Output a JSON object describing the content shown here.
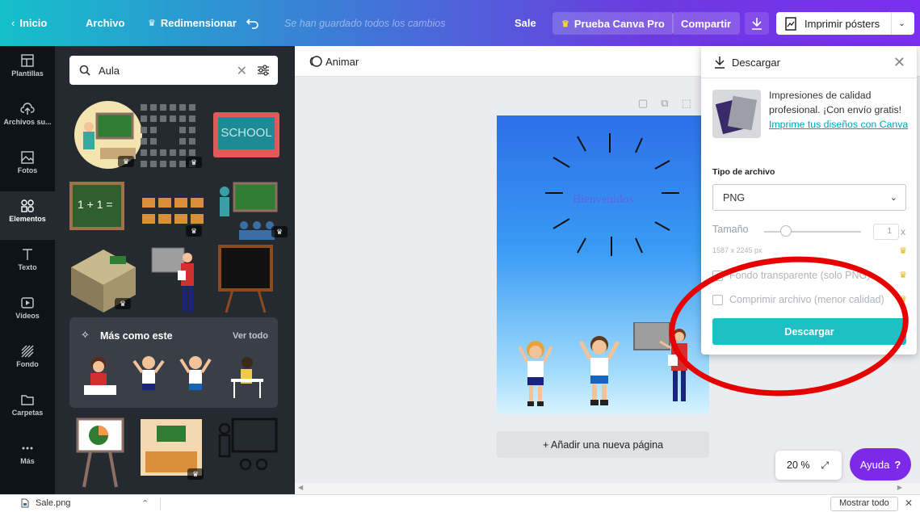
{
  "topbar": {
    "home": "Inicio",
    "file": "Archivo",
    "resize": "Redimensionar",
    "saved": "Se han guardado todos los cambios",
    "doc_name": "Sale",
    "pro": "Prueba Canva Pro",
    "share": "Compartir",
    "print": "Imprimir pósters"
  },
  "rail": {
    "items": [
      {
        "label": "Plantillas",
        "icon": "templates-icon"
      },
      {
        "label": "Archivos su...",
        "icon": "upload-icon"
      },
      {
        "label": "Fotos",
        "icon": "photos-icon"
      },
      {
        "label": "Elementos",
        "icon": "elements-icon"
      },
      {
        "label": "Texto",
        "icon": "text-icon"
      },
      {
        "label": "Vídeos",
        "icon": "video-icon"
      },
      {
        "label": "Fondo",
        "icon": "background-icon"
      },
      {
        "label": "Carpetas",
        "icon": "folder-icon"
      },
      {
        "label": "Más",
        "icon": "more-icon"
      }
    ],
    "active": "Elementos"
  },
  "search": {
    "value": "Aula"
  },
  "more_like_this": {
    "title": "Más como este",
    "see_all": "Ver todo"
  },
  "elements": {
    "school_label": "SCHOOL",
    "math_label": "1 + 1 ="
  },
  "canvas": {
    "animate": "Animar",
    "welcome": "Bienvenidos",
    "add_page": "+ Añadir una nueva página",
    "zoom": "20 %",
    "help": "Ayuda",
    "help_mark": "?"
  },
  "download_panel": {
    "title": "Descargar",
    "promo_text": "Impresiones de calidad profesional. ¡Con envío gratis!",
    "promo_link": "Imprime tus diseños con Canva",
    "file_type_label": "Tipo de archivo",
    "file_type": "PNG",
    "size_label": "Tamaño",
    "size_value": "1",
    "size_x": "x",
    "dimensions": "1587 x 2245 px",
    "transparent": "Fondo transparente (solo PNG)",
    "compress": "Comprimir archivo (menor calidad)",
    "button": "Descargar"
  },
  "downloads_bar": {
    "file": "Sale.png",
    "show_all": "Mostrar todo"
  },
  "colors": {
    "accent": "#1fbfc6",
    "help": "#7d2ae8",
    "annotation": "#e60000",
    "pro_crown": "#e6b400"
  }
}
